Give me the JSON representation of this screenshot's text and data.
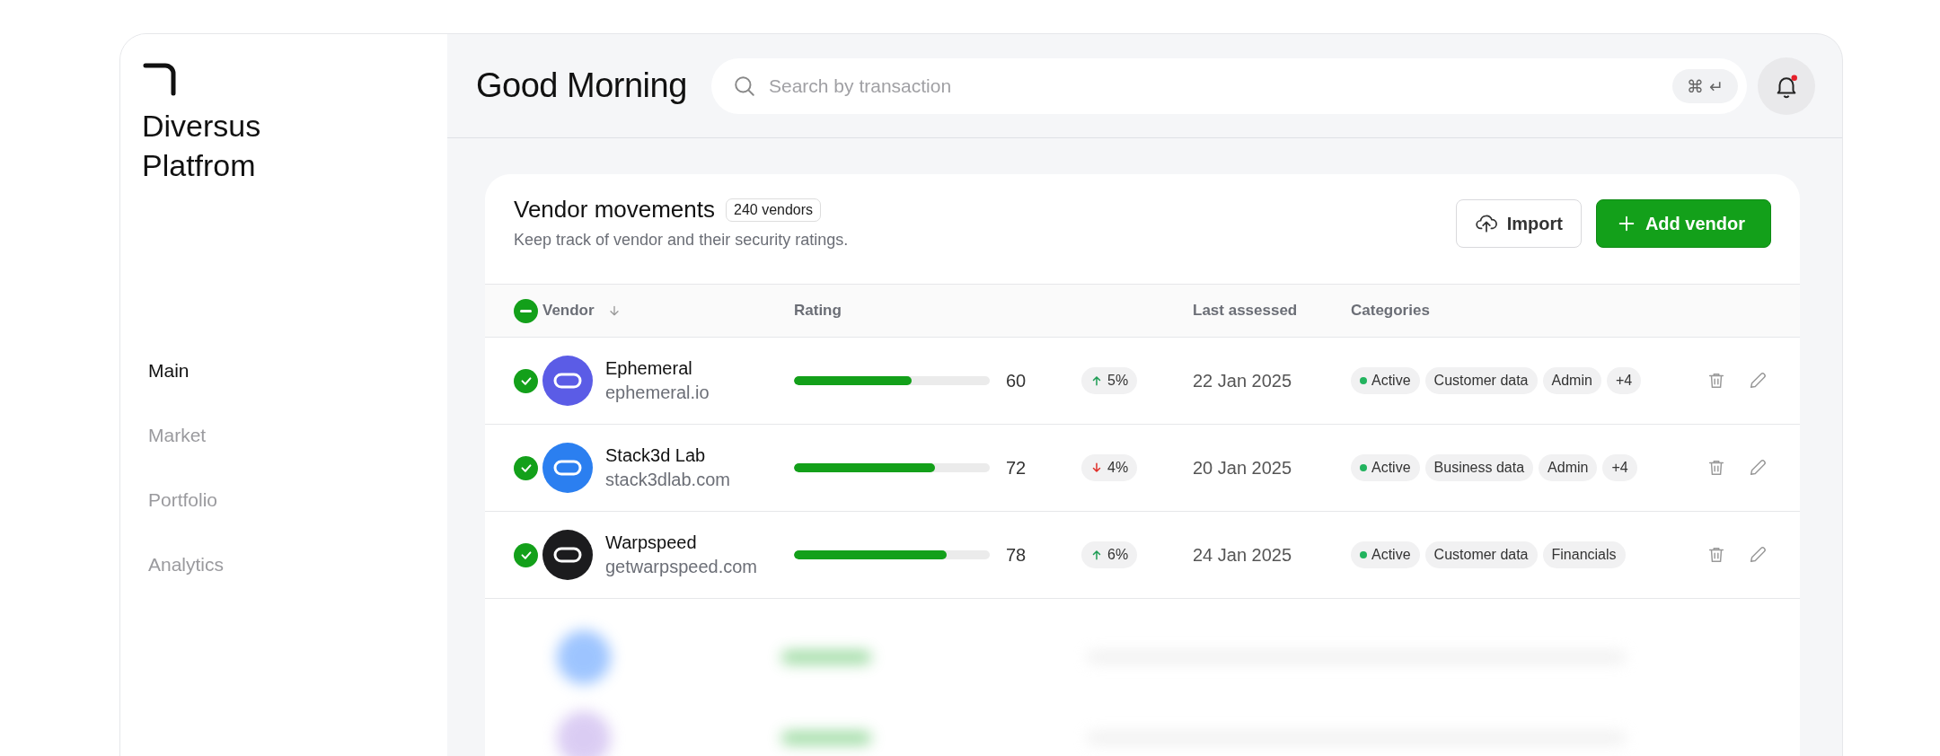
{
  "sidebar": {
    "brand": "Diversus Platfrom",
    "items": [
      {
        "label": "Main",
        "selected": true
      },
      {
        "label": "Market",
        "selected": false
      },
      {
        "label": "Portfolio",
        "selected": false
      },
      {
        "label": "Analytics",
        "selected": false
      }
    ]
  },
  "header": {
    "title": "Good Morning",
    "search": {
      "placeholder": "Search by transaction",
      "shortcut": "⌘ ↵"
    },
    "notifications": {
      "unread": true
    }
  },
  "panel": {
    "title": "Vendor movements",
    "count": "240 vendors",
    "subtitle": "Keep track of vendor and their security ratings.",
    "buttons": [
      {
        "label": "Import",
        "kind": "secondary"
      },
      {
        "label": "Add vendor",
        "kind": "primary"
      }
    ]
  },
  "table": {
    "select_all": {
      "indeterminate": true
    },
    "columns": [
      "Vendor",
      "Rating",
      "Last assessed",
      "Categories"
    ],
    "rows": [
      {
        "name": "Ephemeral",
        "domain": "ephemeral.io",
        "color": "#5b5ce6",
        "checked": true,
        "level": 0.6,
        "rating": "60",
        "change": {
          "rising": true,
          "text": "5%"
        },
        "date": "22 Jan 2025",
        "tags": [
          {
            "kind": "status",
            "label": "Active",
            "color": "#22b35e"
          },
          {
            "kind": "tag",
            "label": "Customer data"
          },
          {
            "kind": "tag",
            "label": "Admin"
          },
          {
            "kind": "tag",
            "label": "+4"
          }
        ]
      },
      {
        "name": "Stack3d Lab",
        "domain": "stack3dlab.com",
        "color": "#2b7ff0",
        "checked": true,
        "level": 0.72,
        "rating": "72",
        "change": {
          "rising": false,
          "text": "4%"
        },
        "date": "20 Jan 2025",
        "tags": [
          {
            "kind": "status",
            "label": "Active",
            "color": "#22b35e"
          },
          {
            "kind": "tag",
            "label": "Business data"
          },
          {
            "kind": "tag",
            "label": "Admin"
          },
          {
            "kind": "tag",
            "label": "+4"
          }
        ]
      },
      {
        "name": "Warpspeed",
        "domain": "getwarpspeed.com",
        "color": "#1c1c1e",
        "checked": true,
        "level": 0.78,
        "rating": "78",
        "change": {
          "rising": true,
          "text": "6%"
        },
        "date": "24 Jan 2025",
        "tags": [
          {
            "kind": "status",
            "label": "Active",
            "color": "#22b35e"
          },
          {
            "kind": "tag",
            "label": "Customer data"
          },
          {
            "kind": "tag",
            "label": "Financials"
          }
        ]
      }
    ]
  }
}
